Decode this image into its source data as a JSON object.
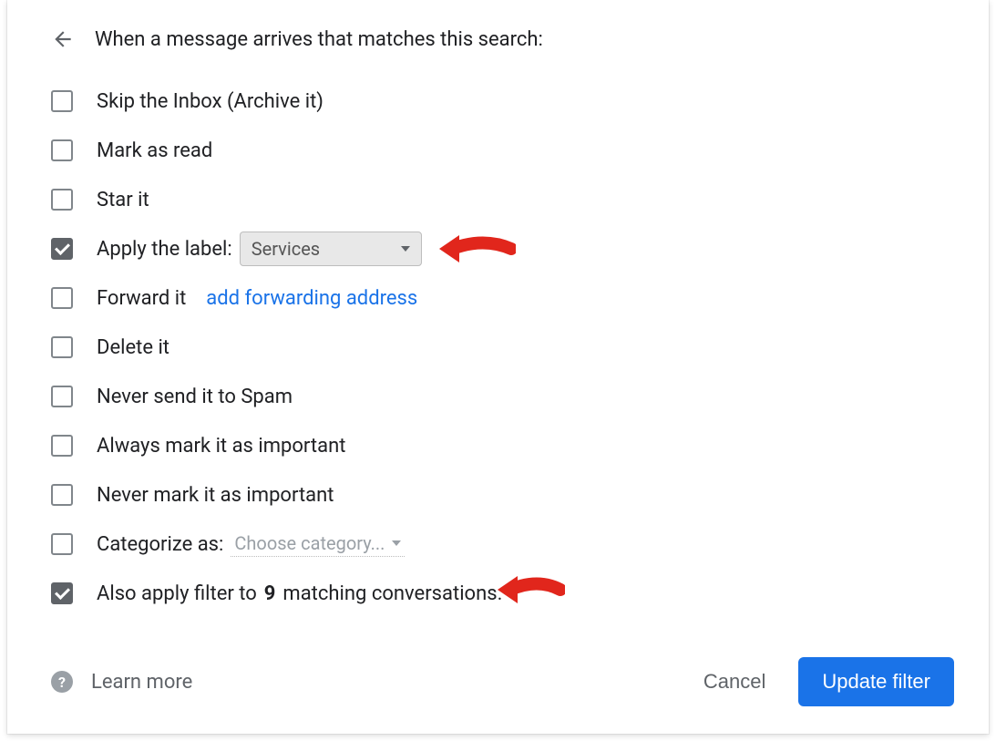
{
  "header": {
    "title": "When a message arrives that matches this search:"
  },
  "options": {
    "skip_inbox": {
      "label": "Skip the Inbox (Archive it)",
      "checked": false
    },
    "mark_read": {
      "label": "Mark as read",
      "checked": false
    },
    "star_it": {
      "label": "Star it",
      "checked": false
    },
    "apply_label": {
      "label": "Apply the label:",
      "checked": true,
      "selected": "Services"
    },
    "forward_it": {
      "label": "Forward it",
      "checked": false,
      "link": "add forwarding address"
    },
    "delete_it": {
      "label": "Delete it",
      "checked": false
    },
    "never_spam": {
      "label": "Never send it to Spam",
      "checked": false
    },
    "always_important": {
      "label": "Always mark it as important",
      "checked": false
    },
    "never_important": {
      "label": "Never mark it as important",
      "checked": false
    },
    "categorize": {
      "label": "Categorize as:",
      "checked": false,
      "selected": "Choose category..."
    },
    "also_apply": {
      "prefix": "Also apply filter to ",
      "count": "9",
      "suffix": " matching conversations.",
      "checked": true
    }
  },
  "footer": {
    "learn_more": "Learn more",
    "cancel": "Cancel",
    "update": "Update filter"
  }
}
